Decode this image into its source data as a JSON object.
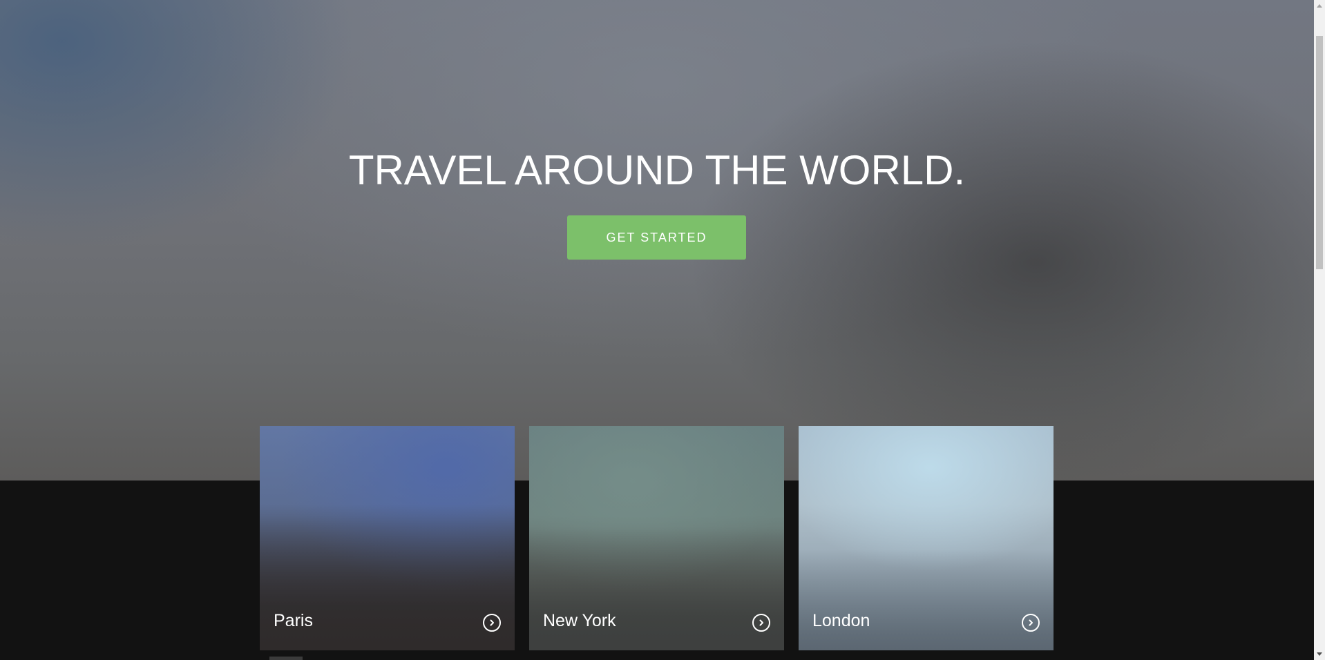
{
  "hero": {
    "title": "TRAVEL AROUND THE WORLD.",
    "cta_label": "GET STARTED"
  },
  "cards": [
    {
      "label": "Paris",
      "icon": "chevron-right-circle-icon"
    },
    {
      "label": "New York",
      "icon": "chevron-right-circle-icon"
    },
    {
      "label": "London",
      "icon": "chevron-right-circle-icon"
    }
  ],
  "colors": {
    "cta_background": "#7cc06a",
    "page_background": "#121212",
    "text": "#ffffff"
  }
}
